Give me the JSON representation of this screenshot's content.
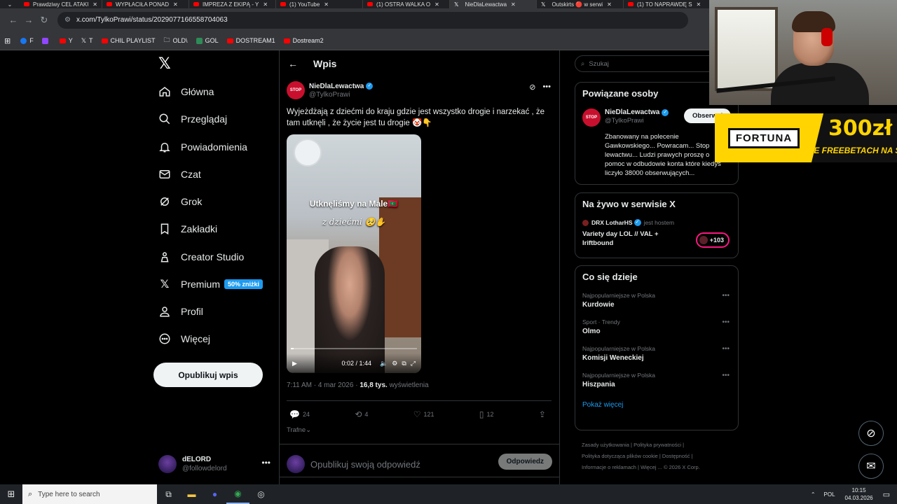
{
  "browser": {
    "tabs": [
      {
        "title": "Prawdziwy CEL ATAKU",
        "icon": "youtube",
        "active": false
      },
      {
        "title": "WYPŁACIŁA PONAD",
        "icon": "youtube",
        "active": false
      },
      {
        "title": "IMPREZA Z EKIPĄ - Y",
        "icon": "youtube",
        "active": false
      },
      {
        "title": "(1) YouTube",
        "icon": "youtube",
        "active": false
      },
      {
        "title": "(1) OSTRA WALKA O",
        "icon": "youtube",
        "active": false
      },
      {
        "title": "NieDlaLewactwa",
        "icon": "x",
        "active": true
      },
      {
        "title": "Outskirts 🔴 w serwi",
        "icon": "x",
        "active": false
      },
      {
        "title": "(1) TO NAPRAWDĘ S",
        "icon": "youtube",
        "active": false
      }
    ],
    "url": "x.com/TylkoPrawi/status/2029077166558704063",
    "bookmarks": [
      {
        "label": "F",
        "icon": "facebook"
      },
      {
        "label": "",
        "icon": "twitch"
      },
      {
        "label": "Y",
        "icon": "youtube"
      },
      {
        "label": "T",
        "icon": "x"
      },
      {
        "label": "CHIL PLAYLIST",
        "icon": "youtube"
      },
      {
        "label": "OLD\\",
        "icon": "folder"
      },
      {
        "label": "GOL",
        "icon": "gol"
      },
      {
        "label": "DOSTREAM1",
        "icon": "youtube"
      },
      {
        "label": "Dostream2",
        "icon": "youtube"
      }
    ]
  },
  "nav": {
    "items": [
      {
        "label": "Główna",
        "icon": "home-icon"
      },
      {
        "label": "Przeglądaj",
        "icon": "search-icon"
      },
      {
        "label": "Powiadomienia",
        "icon": "bell-icon"
      },
      {
        "label": "Czat",
        "icon": "mail-icon"
      },
      {
        "label": "Grok",
        "icon": "grok-icon"
      },
      {
        "label": "Zakładki",
        "icon": "bookmark-icon"
      },
      {
        "label": "Creator Studio",
        "icon": "creator-icon"
      },
      {
        "label": "Premium",
        "icon": "x-icon",
        "badge": "50% zniżki"
      },
      {
        "label": "Profil",
        "icon": "person-icon"
      },
      {
        "label": "Więcej",
        "icon": "more-icon"
      }
    ],
    "post_button": "Opublikuj wpis",
    "user": {
      "name": "dELORD",
      "handle": "@followdelord"
    }
  },
  "main": {
    "title": "Wpis",
    "tweet": {
      "author": "NieDlaLewactwa",
      "handle": "@TylkoPrawi",
      "avatar_text": "STOP",
      "text": "Wyjeżdżają z dziećmi do kraju gdzie jest wszystko drogie i narzekać , że tam utknęli , że życie jest tu drogie 🤡👇",
      "video_caption_1": "Utknęliśmy na Male🇲🇻",
      "video_caption_2": "z dziećmi 🥺✋",
      "video_time": "0:02 / 1:44",
      "video_progress": 0.02,
      "time": "7:11 AM · 4 mar 2026",
      "views_count": "16,8 tys.",
      "views_label": "wyświetlenia",
      "replies": "24",
      "reposts": "4",
      "likes": "121",
      "bookmarks": "12"
    },
    "sort_label": "Trafne",
    "reply_placeholder": "Opublikuj swoją odpowiedź",
    "reply_button": "Odpowiedz"
  },
  "right": {
    "search_placeholder": "Szukaj",
    "related": {
      "title": "Powiązane osoby",
      "name": "NieDlaLewactwa",
      "handle": "@TylkoPrawi",
      "follow": "Obserwuj",
      "bio": "Zbanowany na polecenie Gawkowskiego... Powracam... Stop lewactwu... Ludzi prawych proszę o pomoc w odbudowie konta które kiedyś liczyło 38000 obserwujących..."
    },
    "live": {
      "title": "Na żywo w serwisie X",
      "host": "DRX LotharHS",
      "host_suffix": "jest hostem",
      "stream_title": "Variety day LOL // VAL + Iriftbound",
      "count": "+103"
    },
    "trends": {
      "title": "Co się dzieje",
      "items": [
        {
          "meta": "Najpopularniejsze w Polska",
          "name": "Kurdowie"
        },
        {
          "meta": "Sport · Trendy",
          "name": "Olmo"
        },
        {
          "meta": "Najpopularniejsze w Polska",
          "name": "Komisji Weneckiej"
        },
        {
          "meta": "Najpopularniejsze w Polska",
          "name": "Hiszpania"
        }
      ],
      "show_more": "Pokaż więcej"
    },
    "footer": {
      "line1": "Zasady użytkowania  |  Polityka prywatności  |",
      "line2": "Polityka dotycząca plików cookie  |  Dostępność  |",
      "line3": "Informacje o reklamach  |  Więcej ...  © 2026 X Corp."
    }
  },
  "overlay": {
    "fortuna_brand": "FORTUNA",
    "fortuna_amount": "300zł",
    "fortuna_sub": "WE FREEBETACH NA STA"
  },
  "taskbar": {
    "search_placeholder": "Type here to search",
    "lang": "POL",
    "time": "10:15",
    "date": "04.03.2026"
  },
  "colors": {
    "accent": "#1d9bf0",
    "live": "#f91880",
    "fortuna": "#ffd400"
  }
}
